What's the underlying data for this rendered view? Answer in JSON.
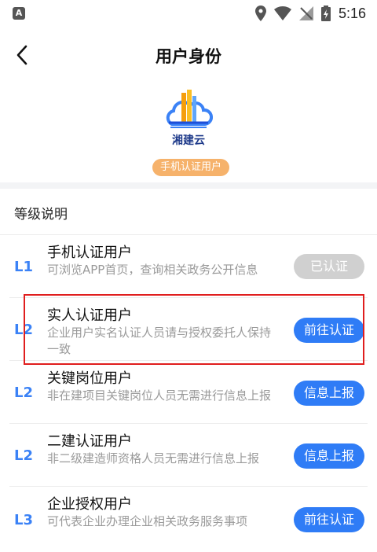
{
  "status_bar": {
    "app_icon_letter": "A",
    "time": "5:16"
  },
  "header": {
    "title": "用户身份"
  },
  "profile": {
    "brand": "湘建云",
    "badge": "手机认证用户"
  },
  "levels_section": {
    "title": "等级说明",
    "items": [
      {
        "code": "L1",
        "name": "手机认证用户",
        "desc": "可浏览APP首页，查询相关政务公开信息",
        "button": "已认证",
        "button_state": "disabled"
      },
      {
        "code": "L2",
        "name": "实人认证用户",
        "desc": "企业用户实名认证人员请与授权委托人保持一致",
        "button": "前往认证",
        "button_state": "active"
      },
      {
        "code": "L2",
        "name": "关键岗位用户",
        "desc": "非在建项目关键岗位人员无需进行信息上报",
        "button": "信息上报",
        "button_state": "active"
      },
      {
        "code": "L2",
        "name": "二建认证用户",
        "desc": "非二级建造师资格人员无需进行信息上报",
        "button": "信息上报",
        "button_state": "active"
      },
      {
        "code": "L3",
        "name": "企业授权用户",
        "desc": "可代表企业办理企业相关政务服务事项",
        "button": "前往认证",
        "button_state": "active"
      }
    ]
  },
  "colors": {
    "accent": "#2f7cf6",
    "badge": "#f6b26b",
    "highlight": "#e01e1e",
    "disabled": "#d0d0d0"
  }
}
